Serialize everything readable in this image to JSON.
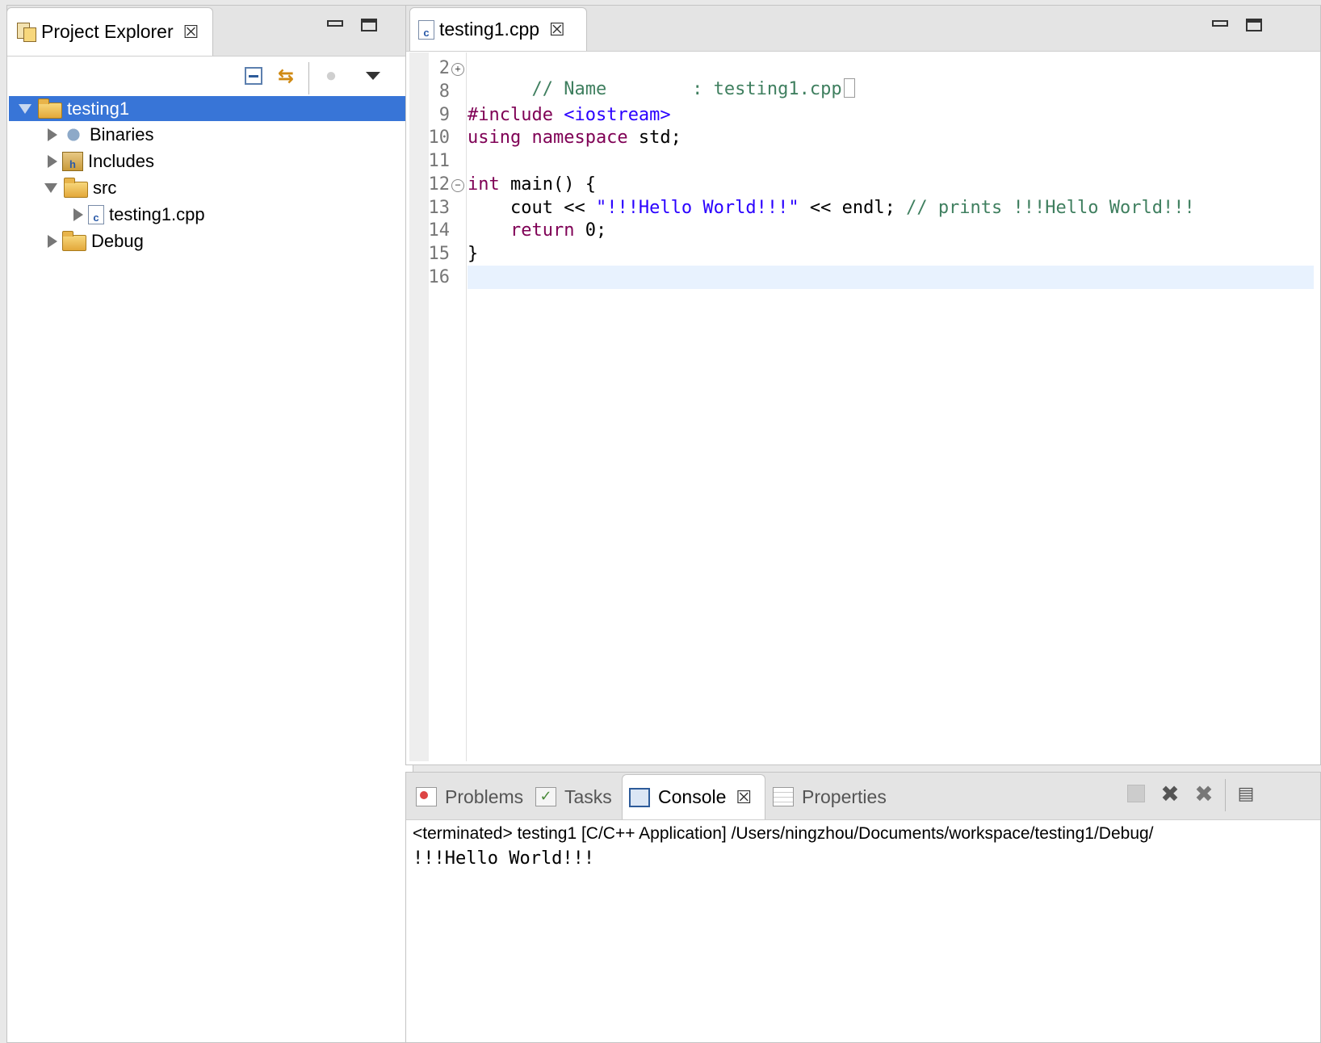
{
  "explorer": {
    "tab_label": "Project Explorer",
    "tree": [
      {
        "label": "testing1",
        "icon": "project-icon",
        "level": 0,
        "expanded": true,
        "selected": true
      },
      {
        "label": "Binaries",
        "icon": "binaries-icon",
        "level": 1,
        "expanded": false
      },
      {
        "label": "Includes",
        "icon": "includes-icon",
        "level": 1,
        "expanded": false
      },
      {
        "label": "src",
        "icon": "source-folder-icon",
        "level": 1,
        "expanded": true
      },
      {
        "label": "testing1.cpp",
        "icon": "cpp-file-icon",
        "level": 2,
        "expanded": false
      },
      {
        "label": "Debug",
        "icon": "folder-icon",
        "level": 1,
        "expanded": false
      }
    ]
  },
  "editor": {
    "tab_label": "testing1.cpp",
    "line_numbers": [
      "2",
      "8",
      "9",
      "10",
      "11",
      "12",
      "13",
      "14",
      "15",
      "16"
    ],
    "lines": {
      "l2": "// Name        : testing1.cpp",
      "l9a": "#include ",
      "l9b": "<iostream>",
      "l10a": "using namespace",
      "l10b": " std;",
      "l12a": "int",
      "l12b": " main() {",
      "l13a": "    cout << ",
      "l13b": "\"!!!Hello World!!!\"",
      "l13c": " << endl; ",
      "l13d": "// prints !!!Hello World!!!",
      "l14a": "    return",
      "l14b": " 0;",
      "l15": "}"
    }
  },
  "console_view": {
    "tabs": [
      {
        "label": "Problems",
        "icon": "problems-icon",
        "active": false
      },
      {
        "label": "Tasks",
        "icon": "tasks-icon",
        "active": false
      },
      {
        "label": "Console",
        "icon": "console-icon",
        "active": true
      },
      {
        "label": "Properties",
        "icon": "properties-icon",
        "active": false
      }
    ],
    "status": "<terminated> testing1 [C/C++ Application] /Users/ningzhou/Documents/workspace/testing1/Debug/",
    "output": "!!!Hello World!!!"
  },
  "colors": {
    "selection": "#3875d7",
    "comment": "#3f7f5f",
    "keyword": "#7f0055",
    "string": "#2a00ff",
    "current_line": "#e8f2fe"
  }
}
